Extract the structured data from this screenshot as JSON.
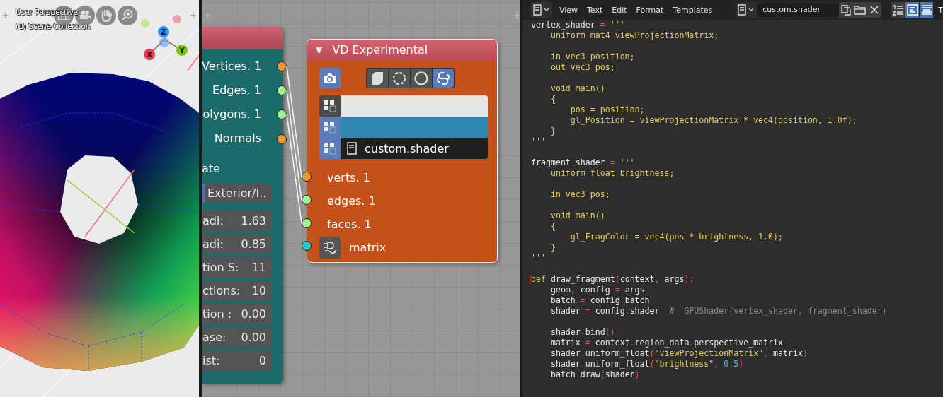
{
  "viewport": {
    "view_name": "User Perspective",
    "collection": "(1) Scene Collection",
    "nav_buttons": [
      {
        "kind": "grid"
      },
      {
        "kind": "camera"
      },
      {
        "kind": "hand"
      },
      {
        "kind": "zoom"
      }
    ],
    "axes": [
      {
        "label": "X",
        "color": "#f0364f"
      },
      {
        "label": "Y",
        "color": "#84c50e"
      },
      {
        "label": "Z",
        "color": "#2c8fff"
      }
    ]
  },
  "node_editor": {
    "left_node": {
      "outputs": [
        {
          "label": "Vertices. 1",
          "color": "#e89a30",
          "linked": true
        },
        {
          "label": "Edges. 1",
          "color": "#9ef58e",
          "linked": true
        },
        {
          "label": "olygons. 1",
          "color": "#9ef58e",
          "linked": true
        },
        {
          "label": "Normals",
          "color": "#e89a30",
          "linked": false
        }
      ],
      "section_label": "ate",
      "mode_options": [
        {
          "selected": true
        },
        {
          "label": "Exterior/I..",
          "selected": false
        }
      ],
      "fields": [
        {
          "label": "adi:",
          "value": "1.63"
        },
        {
          "label": "adi:",
          "value": "0.85"
        },
        {
          "label": "tion S:",
          "value": "11"
        },
        {
          "label": "ctions:",
          "value": "10"
        },
        {
          "label": "tion :",
          "value": "0.00"
        },
        {
          "label": "ase:",
          "value": "0.00"
        },
        {
          "label": "ist:",
          "value": "0"
        }
      ]
    },
    "right_node": {
      "title": "VD Experimental",
      "collapse_glyph": "▼",
      "camera_selected": true,
      "modes": [
        {
          "kind": "solid",
          "selected": false
        },
        {
          "kind": "dotted",
          "selected": false
        },
        {
          "kind": "ring",
          "selected": false
        },
        {
          "kind": "snake",
          "selected": true
        }
      ],
      "rows": [
        {
          "kind": "color",
          "color": "#e6e6e6",
          "icon_selected": false
        },
        {
          "kind": "color",
          "color": "#2f86af",
          "icon_selected": true
        },
        {
          "kind": "text",
          "value": "custom.shader",
          "icon_selected": true
        }
      ],
      "inputs": [
        {
          "label": "verts. 1",
          "color": "#e89a30",
          "linked": true
        },
        {
          "label": "edges. 1",
          "color": "#9ef58e",
          "linked": true
        },
        {
          "label": "faces. 1",
          "color": "#9ef58e",
          "linked": true
        },
        {
          "label": "matrix",
          "color": "#2ec4cf",
          "linked": false,
          "plug": true
        }
      ]
    }
  },
  "text_editor": {
    "menus": [
      "View",
      "Text",
      "Edit",
      "Format",
      "Templates"
    ],
    "file_name": "custom.shader",
    "toggles": [
      {
        "kind": "line_numbers",
        "selected": false
      },
      {
        "kind": "word_wrap",
        "selected": true
      },
      {
        "kind": "syntax",
        "selected": true
      }
    ],
    "edge_label": "T",
    "lines": [
      {
        "kind": "code",
        "tokens": [
          {
            "kind": "name",
            "text": "vertex_shader "
          },
          {
            "kind": "op",
            "text": "="
          },
          {
            "kind": "str",
            "text": " '''"
          }
        ]
      },
      {
        "kind": "code",
        "tokens": [
          {
            "kind": "str",
            "text": "    uniform mat4 viewProjectionMatrix;"
          }
        ]
      },
      {
        "kind": "blank"
      },
      {
        "kind": "code",
        "tokens": [
          {
            "kind": "str",
            "text": "    in vec3 position;"
          }
        ]
      },
      {
        "kind": "code",
        "tokens": [
          {
            "kind": "str",
            "text": "    out vec3 pos;"
          }
        ]
      },
      {
        "kind": "blank"
      },
      {
        "kind": "code",
        "tokens": [
          {
            "kind": "str",
            "text": "    void main()"
          }
        ]
      },
      {
        "kind": "code",
        "tokens": [
          {
            "kind": "str",
            "text": "    {"
          }
        ]
      },
      {
        "kind": "code",
        "tokens": [
          {
            "kind": "str",
            "text": "        pos = position;"
          }
        ]
      },
      {
        "kind": "code",
        "tokens": [
          {
            "kind": "str",
            "text": "        gl_Position = viewProjectionMatrix * vec4(position, 1.0f);"
          }
        ]
      },
      {
        "kind": "code",
        "tokens": [
          {
            "kind": "str",
            "text": "    }"
          }
        ]
      },
      {
        "kind": "code",
        "tokens": [
          {
            "kind": "str",
            "text": "'''"
          }
        ]
      },
      {
        "kind": "blank"
      },
      {
        "kind": "code",
        "tokens": [
          {
            "kind": "name",
            "text": "fragment_shader "
          },
          {
            "kind": "op",
            "text": "="
          },
          {
            "kind": "str",
            "text": " '''"
          }
        ]
      },
      {
        "kind": "code",
        "tokens": [
          {
            "kind": "str",
            "text": "    uniform float brightness;"
          }
        ]
      },
      {
        "kind": "blank"
      },
      {
        "kind": "code",
        "tokens": [
          {
            "kind": "str",
            "text": "    in vec3 pos;"
          }
        ]
      },
      {
        "kind": "blank"
      },
      {
        "kind": "code",
        "tokens": [
          {
            "kind": "str",
            "text": "    void main()"
          }
        ]
      },
      {
        "kind": "code",
        "tokens": [
          {
            "kind": "str",
            "text": "    {"
          }
        ]
      },
      {
        "kind": "code",
        "tokens": [
          {
            "kind": "str",
            "text": "        gl_FragColor = vec4(pos * brightness, 1.0);"
          }
        ]
      },
      {
        "kind": "code",
        "tokens": [
          {
            "kind": "str",
            "text": "    }"
          }
        ]
      },
      {
        "kind": "code",
        "tokens": [
          {
            "kind": "str",
            "text": "'''"
          }
        ]
      },
      {
        "kind": "blank"
      },
      {
        "kind": "code",
        "cursor": true,
        "tokens": [
          {
            "kind": "kw",
            "text": "def"
          },
          {
            "kind": "name",
            "text": " draw_fragment"
          },
          {
            "kind": "op",
            "text": "("
          },
          {
            "kind": "name",
            "text": "context"
          },
          {
            "kind": "op",
            "text": ","
          },
          {
            "kind": "name",
            "text": " args"
          },
          {
            "kind": "op",
            "text": "):"
          }
        ]
      },
      {
        "kind": "code",
        "tokens": [
          {
            "kind": "name",
            "text": "    geom"
          },
          {
            "kind": "op",
            "text": ","
          },
          {
            "kind": "name",
            "text": " config "
          },
          {
            "kind": "op",
            "text": "="
          },
          {
            "kind": "name",
            "text": " args"
          }
        ]
      },
      {
        "kind": "code",
        "tokens": [
          {
            "kind": "name",
            "text": "    batch "
          },
          {
            "kind": "op",
            "text": "="
          },
          {
            "kind": "name",
            "text": " config"
          },
          {
            "kind": "op",
            "text": "."
          },
          {
            "kind": "name",
            "text": "batch"
          }
        ]
      },
      {
        "kind": "code",
        "tokens": [
          {
            "kind": "name",
            "text": "    shader "
          },
          {
            "kind": "op",
            "text": "="
          },
          {
            "kind": "name",
            "text": " config"
          },
          {
            "kind": "op",
            "text": "."
          },
          {
            "kind": "name",
            "text": "shader  "
          },
          {
            "kind": "comment",
            "text": "#  GPUShader(vertex_shader, fragment_shader)"
          }
        ]
      },
      {
        "kind": "blank"
      },
      {
        "kind": "code",
        "tokens": [
          {
            "kind": "name",
            "text": "    shader"
          },
          {
            "kind": "member",
            "text": ".bind"
          },
          {
            "kind": "op",
            "text": "()"
          }
        ]
      },
      {
        "kind": "code",
        "tokens": [
          {
            "kind": "name",
            "text": "    matrix "
          },
          {
            "kind": "op",
            "text": "="
          },
          {
            "kind": "name",
            "text": " context"
          },
          {
            "kind": "op",
            "text": "."
          },
          {
            "kind": "name",
            "text": "region_data"
          },
          {
            "kind": "op",
            "text": "."
          },
          {
            "kind": "name",
            "text": "perspective_matrix"
          }
        ]
      },
      {
        "kind": "code",
        "tokens": [
          {
            "kind": "name",
            "text": "    shader"
          },
          {
            "kind": "op",
            "text": "."
          },
          {
            "kind": "name",
            "text": "uniform_float"
          },
          {
            "kind": "op",
            "text": "("
          },
          {
            "kind": "str",
            "text": "\"viewProjectionMatrix\""
          },
          {
            "kind": "op",
            "text": ","
          },
          {
            "kind": "name",
            "text": " matrix"
          },
          {
            "kind": "op",
            "text": ")"
          }
        ]
      },
      {
        "kind": "code",
        "tokens": [
          {
            "kind": "name",
            "text": "    shader"
          },
          {
            "kind": "op",
            "text": "."
          },
          {
            "kind": "name",
            "text": "uniform_float"
          },
          {
            "kind": "op",
            "text": "("
          },
          {
            "kind": "str",
            "text": "\"brightness\""
          },
          {
            "kind": "op",
            "text": ","
          },
          {
            "kind": "num",
            "text": " 0.5"
          },
          {
            "kind": "op",
            "text": ")"
          }
        ]
      },
      {
        "kind": "code",
        "tokens": [
          {
            "kind": "name",
            "text": "    batch"
          },
          {
            "kind": "op",
            "text": "."
          },
          {
            "kind": "name",
            "text": "draw"
          },
          {
            "kind": "op",
            "text": "("
          },
          {
            "kind": "name",
            "text": "shader"
          },
          {
            "kind": "op",
            "text": ")"
          }
        ]
      }
    ]
  }
}
